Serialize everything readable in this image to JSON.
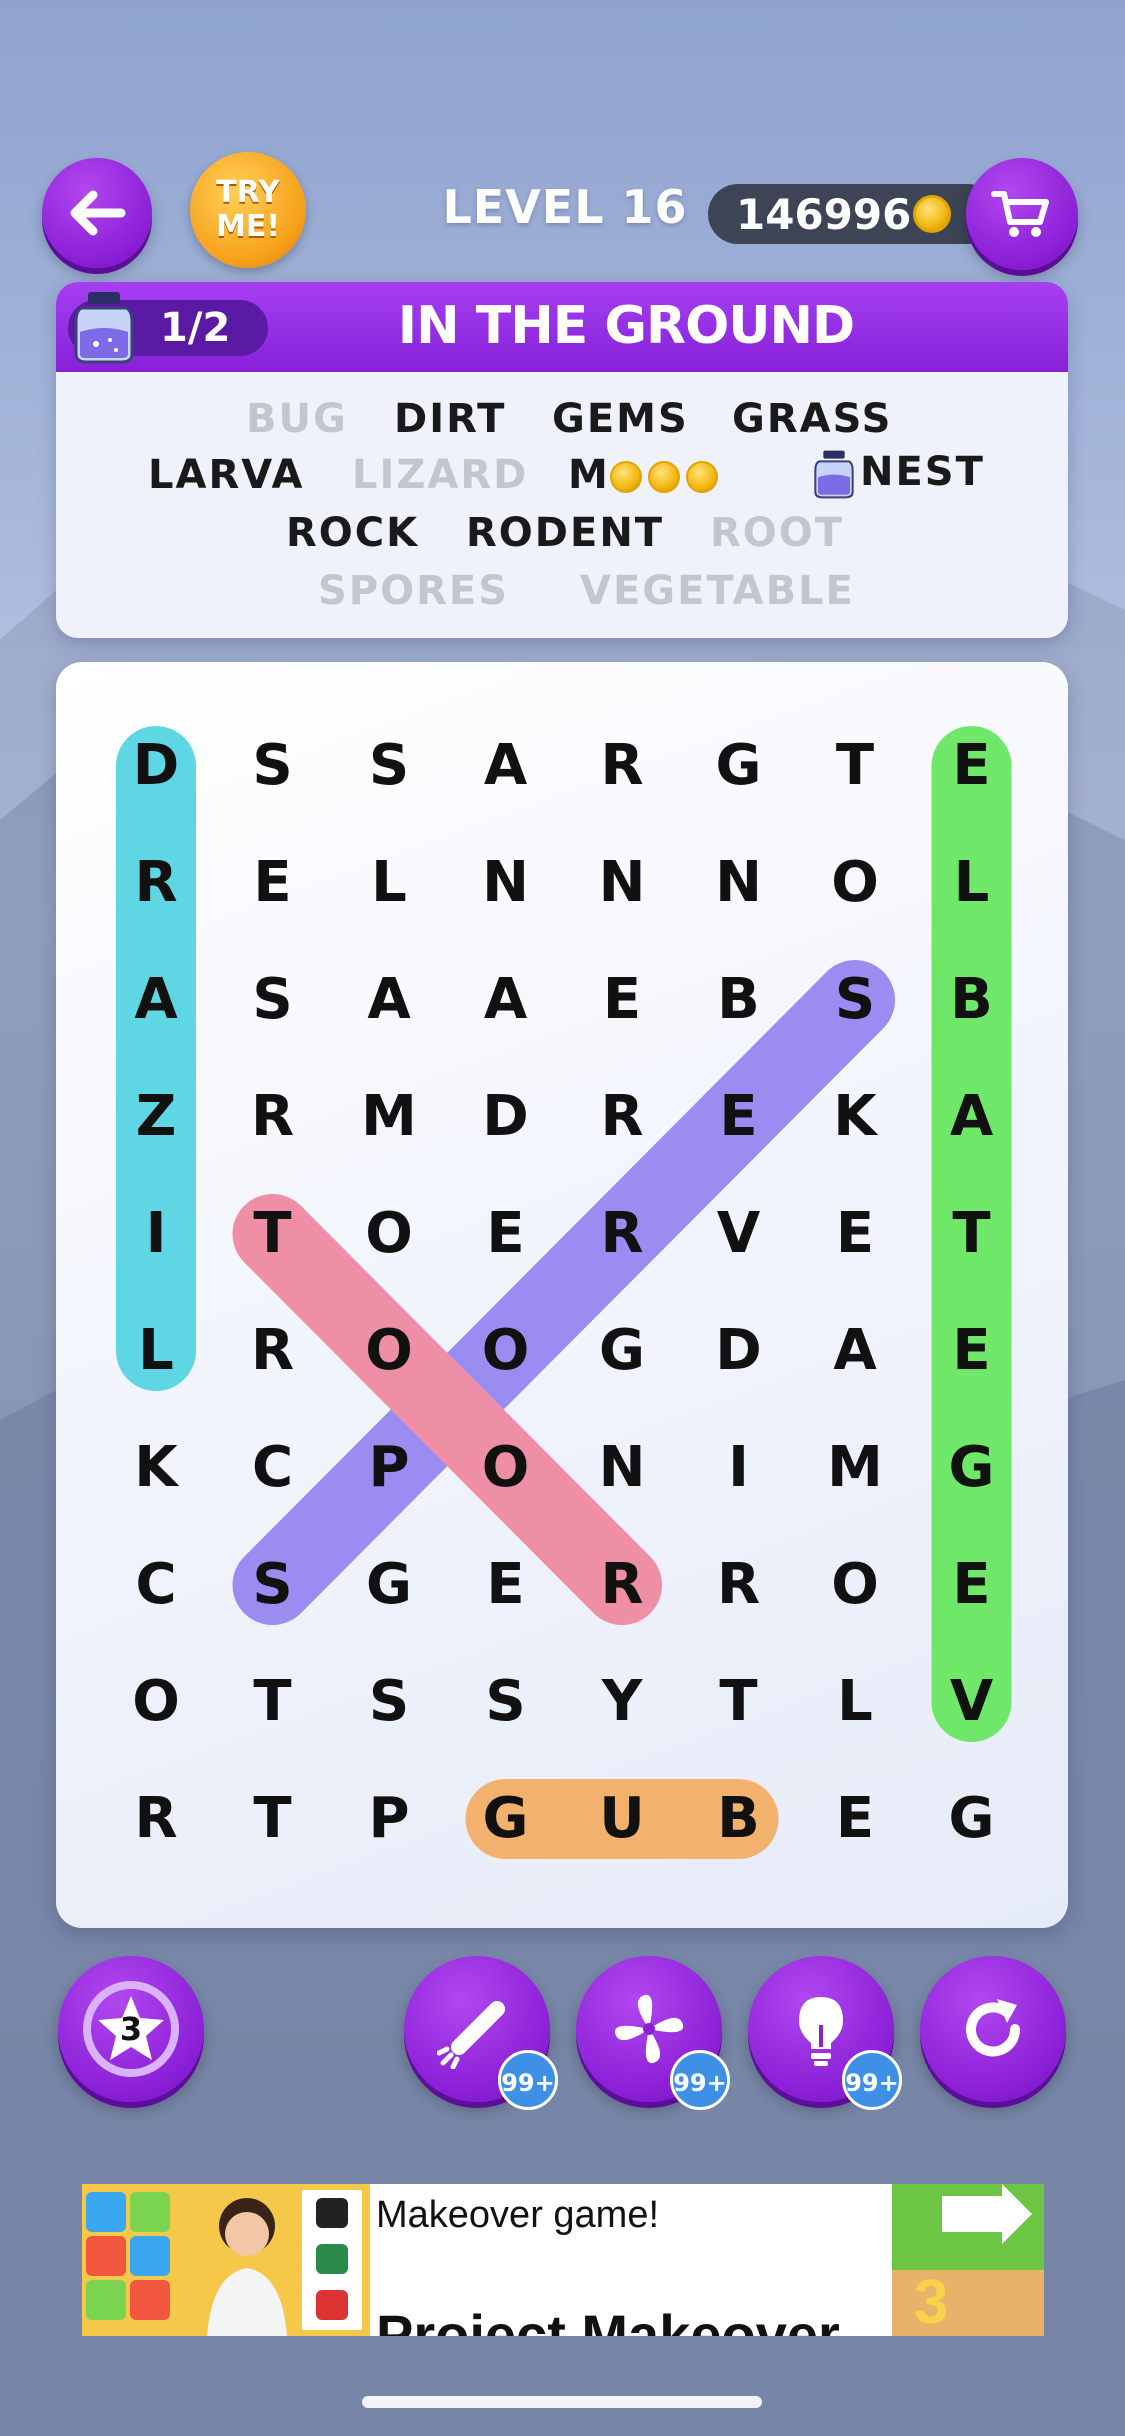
{
  "header": {
    "back_icon": "arrow-left-icon",
    "try_me_line1": "TRY",
    "try_me_line2": "ME!",
    "level": "LEVEL 16",
    "coins": "146996",
    "cart_icon": "shopping-cart-icon"
  },
  "word_card": {
    "progress": "1/2",
    "theme": "IN THE GROUND",
    "words": [
      {
        "text": "BUG",
        "found": true
      },
      {
        "text": "DIRT",
        "found": false
      },
      {
        "text": "GEMS",
        "found": false
      },
      {
        "text": "GRASS",
        "found": false
      },
      {
        "text": "LARVA",
        "found": false
      },
      {
        "text": "LIZARD",
        "found": true
      },
      {
        "text": "M",
        "found": false,
        "hidden_letters": 3
      },
      {
        "text": "NEST",
        "found": false,
        "has_jar": true
      },
      {
        "text": "ROCK",
        "found": false
      },
      {
        "text": "RODENT",
        "found": false
      },
      {
        "text": "ROOT",
        "found": true
      },
      {
        "text": "SPORES",
        "found": true
      },
      {
        "text": "VEGETABLE",
        "found": true
      }
    ]
  },
  "grid": {
    "rows": [
      [
        "D",
        "S",
        "S",
        "A",
        "R",
        "G",
        "T",
        "E"
      ],
      [
        "R",
        "E",
        "L",
        "N",
        "N",
        "N",
        "O",
        "L"
      ],
      [
        "A",
        "S",
        "A",
        "A",
        "E",
        "B",
        "S",
        "B"
      ],
      [
        "Z",
        "R",
        "M",
        "D",
        "R",
        "E",
        "K",
        "A"
      ],
      [
        "I",
        "T",
        "O",
        "E",
        "R",
        "V",
        "E",
        "T"
      ],
      [
        "L",
        "R",
        "O",
        "O",
        "G",
        "D",
        "A",
        "E"
      ],
      [
        "K",
        "C",
        "P",
        "O",
        "N",
        "I",
        "M",
        "G"
      ],
      [
        "C",
        "S",
        "G",
        "E",
        "R",
        "R",
        "O",
        "E"
      ],
      [
        "O",
        "T",
        "S",
        "S",
        "Y",
        "T",
        "L",
        "V"
      ],
      [
        "R",
        "T",
        "P",
        "G",
        "U",
        "B",
        "E",
        "G"
      ]
    ],
    "highlights": [
      {
        "word": "LIZARD",
        "color": "#5fd6e3",
        "from": [
          5,
          0
        ],
        "to": [
          0,
          0
        ]
      },
      {
        "word": "VEGETABLE",
        "color": "#6fe86a",
        "from": [
          8,
          7
        ],
        "to": [
          0,
          7
        ]
      },
      {
        "word": "SPORES",
        "color": "#9b8cf2",
        "from": [
          7,
          1
        ],
        "to": [
          2,
          6
        ]
      },
      {
        "word": "ROOT",
        "color": "#ee8fa6",
        "from": [
          7,
          4
        ],
        "to": [
          4,
          1
        ]
      },
      {
        "word": "BUG",
        "color": "#f3b16e",
        "from": [
          9,
          5
        ],
        "to": [
          9,
          3
        ]
      }
    ]
  },
  "tools": {
    "star_count": "3",
    "rocket_badge": "99+",
    "fan_badge": "99+",
    "hint_badge": "99+"
  },
  "ad": {
    "line1": "Makeover game!",
    "line2": "Project Makeover",
    "corner_digit": "3"
  }
}
